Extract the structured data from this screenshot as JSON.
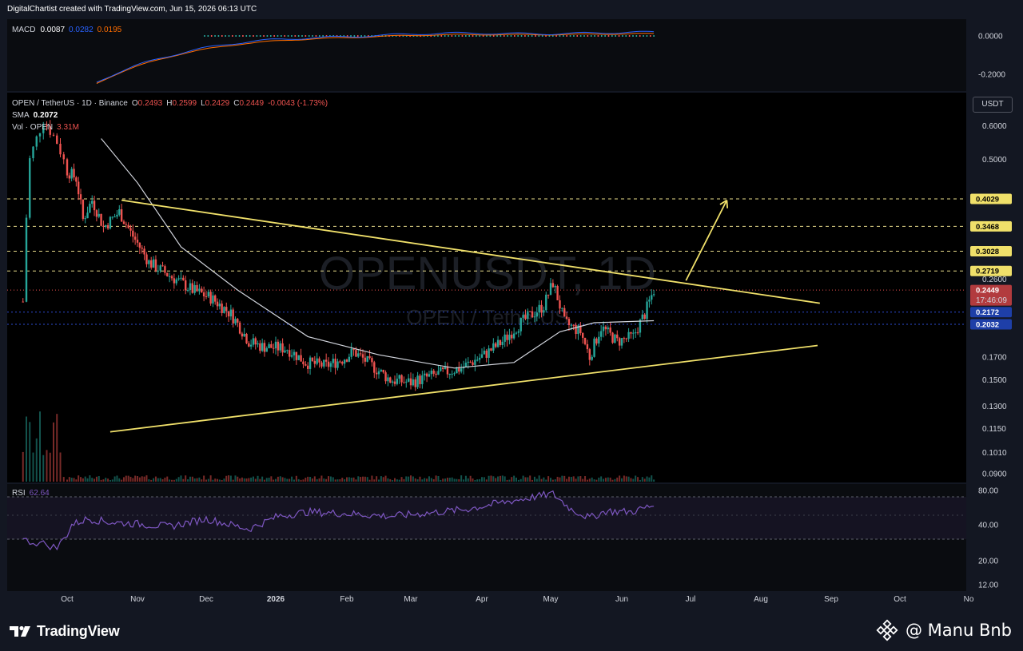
{
  "source_line": "DigitalChartist created with TradingView.com, Jun 15, 2026 06:13 UTC",
  "macd": {
    "label": "MACD",
    "v1": "0.0087",
    "v2": "0.0282",
    "v3": "0.0195",
    "ticks": [
      "0.0000",
      "-0.2000"
    ]
  },
  "symbol_line": {
    "name": "OPEN / TetherUS · 1D · Binance",
    "o_label": "O",
    "o": "0.2493",
    "h_label": "H",
    "h": "0.2599",
    "l_label": "L",
    "l": "0.2429",
    "c_label": "C",
    "c": "0.2449",
    "change": "-0.0043 (-1.73%)"
  },
  "sma": {
    "label": "SMA",
    "value": "0.2072"
  },
  "vol": {
    "label": "Vol · OPEN",
    "value": "3.31M"
  },
  "currency_button": "USDT",
  "watermark": {
    "main": "OPENUSDT, 1D",
    "sub": "OPEN / TetherUS"
  },
  "price_axis": {
    "ticks": [
      "0.6000",
      "0.5000",
      "0.2600",
      "0.1700",
      "0.1500",
      "0.1300",
      "0.1150",
      "0.1010",
      "0.0900"
    ],
    "badges": [
      {
        "text": "0.4029",
        "kind": "yellow"
      },
      {
        "text": "0.3468",
        "kind": "yellow"
      },
      {
        "text": "0.3028",
        "kind": "yellow"
      },
      {
        "text": "0.2719",
        "kind": "yellow"
      },
      {
        "text": "0.2449",
        "kind": "red",
        "sub": "17:46:09"
      },
      {
        "text": "0.2172",
        "kind": "blue"
      },
      {
        "text": "0.2032",
        "kind": "blue"
      }
    ]
  },
  "rsi": {
    "label": "RSI",
    "value": "62.64",
    "ticks": [
      "80.00",
      "40.00",
      "20.00",
      "12.00"
    ]
  },
  "time_axis": [
    "Oct",
    "Nov",
    "Dec",
    "2026",
    "Feb",
    "Mar",
    "Apr",
    "May",
    "Jun",
    "Jul",
    "Aug",
    "Sep",
    "Oct",
    "No"
  ],
  "footer": {
    "brand": "TradingView",
    "credit": "@ Manu Bnb"
  },
  "colors": {
    "bg": "#131722",
    "up": "#26a69a",
    "down": "#ef5350",
    "trendline": "#f0e06a",
    "sma": "#d1d4dc",
    "rsi": "#7e57c2",
    "macd": "#2962ff",
    "signal": "#ff6d00"
  },
  "chart_data": {
    "type": "candlestick",
    "symbol": "OPEN / TetherUS",
    "interval": "1D",
    "exchange": "Binance",
    "log_scale": true,
    "last": {
      "open": 0.2493,
      "high": 0.2599,
      "low": 0.2429,
      "close": 0.2449,
      "change": -0.0043,
      "change_pct": -1.73
    },
    "sma_value": 0.2072,
    "price_range": [
      0.088,
      0.67
    ],
    "horizontal_levels": [
      0.4029,
      0.3468,
      0.3028,
      0.2719,
      0.2172,
      0.2032
    ],
    "price_path": [
      [
        "2025-09-18",
        0.23
      ],
      [
        "2025-09-20",
        0.5
      ],
      [
        "2025-09-24",
        0.62
      ],
      [
        "2025-09-28",
        0.55
      ],
      [
        "2025-10-01",
        0.47
      ],
      [
        "2025-10-05",
        0.45
      ],
      [
        "2025-10-08",
        0.36
      ],
      [
        "2025-10-12",
        0.4
      ],
      [
        "2025-10-17",
        0.345
      ],
      [
        "2025-10-24",
        0.375
      ],
      [
        "2025-10-29",
        0.335
      ],
      [
        "2025-11-06",
        0.285
      ],
      [
        "2025-11-15",
        0.265
      ],
      [
        "2025-11-25",
        0.245
      ],
      [
        "2025-12-03",
        0.235
      ],
      [
        "2025-12-12",
        0.215
      ],
      [
        "2025-12-20",
        0.185
      ],
      [
        "2025-12-26",
        0.18
      ],
      [
        "2026-01-06",
        0.178
      ],
      [
        "2026-01-14",
        0.165
      ],
      [
        "2026-01-23",
        0.162
      ],
      [
        "2026-01-30",
        0.168
      ],
      [
        "2026-02-04",
        0.175
      ],
      [
        "2026-02-12",
        0.162
      ],
      [
        "2026-02-20",
        0.15
      ],
      [
        "2026-03-01",
        0.148
      ],
      [
        "2026-03-13",
        0.155
      ],
      [
        "2026-03-23",
        0.16
      ],
      [
        "2026-04-02",
        0.172
      ],
      [
        "2026-04-10",
        0.185
      ],
      [
        "2026-04-18",
        0.205
      ],
      [
        "2026-04-28",
        0.225
      ],
      [
        "2026-05-02",
        0.255
      ],
      [
        "2026-05-07",
        0.205
      ],
      [
        "2026-05-14",
        0.195
      ],
      [
        "2026-05-18",
        0.17
      ],
      [
        "2026-05-23",
        0.2
      ],
      [
        "2026-05-30",
        0.185
      ],
      [
        "2026-06-06",
        0.19
      ],
      [
        "2026-06-11",
        0.215
      ],
      [
        "2026-06-15",
        0.2449
      ]
    ],
    "sma_path": [
      [
        "2025-10-16",
        0.56
      ],
      [
        "2025-11-01",
        0.44
      ],
      [
        "2025-11-20",
        0.31
      ],
      [
        "2025-12-15",
        0.245
      ],
      [
        "2026-01-15",
        0.19
      ],
      [
        "2026-02-15",
        0.172
      ],
      [
        "2026-03-20",
        0.16
      ],
      [
        "2026-04-15",
        0.165
      ],
      [
        "2026-05-05",
        0.195
      ],
      [
        "2026-05-20",
        0.205
      ],
      [
        "2026-06-15",
        0.2072
      ]
    ],
    "descending_trendline": [
      [
        "2025-10-25",
        0.4
      ],
      [
        "2026-08-27",
        0.228
      ]
    ],
    "ascending_trendline": [
      [
        "2025-10-20",
        0.113
      ],
      [
        "2026-08-26",
        0.181
      ]
    ],
    "projection_arrow": [
      [
        "2026-06-29",
        0.258
      ],
      [
        "2026-07-17",
        0.4
      ]
    ],
    "rsi_last": 62.64,
    "rsi_bands": [
      70,
      30
    ],
    "macd_last": {
      "macd": 0.0087,
      "signal": 0.0282,
      "hist": 0.0195
    }
  }
}
